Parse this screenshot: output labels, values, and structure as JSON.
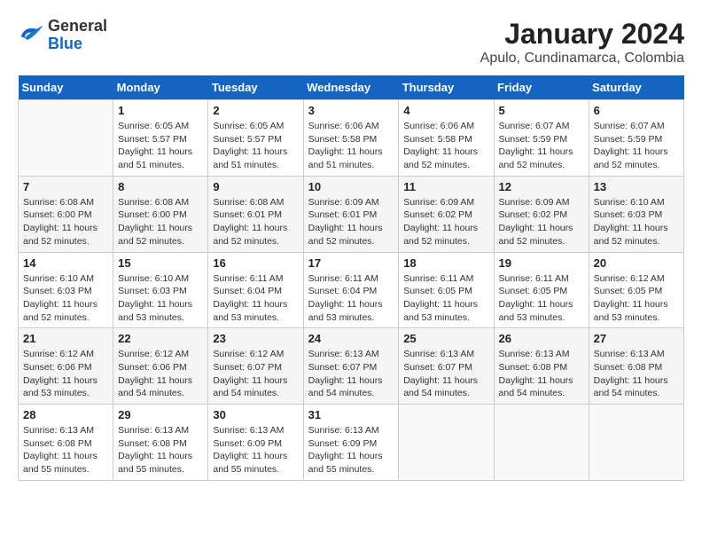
{
  "header": {
    "logo_line1": "General",
    "logo_line2": "Blue",
    "title": "January 2024",
    "subtitle": "Apulo, Cundinamarca, Colombia"
  },
  "weekdays": [
    "Sunday",
    "Monday",
    "Tuesday",
    "Wednesday",
    "Thursday",
    "Friday",
    "Saturday"
  ],
  "weeks": [
    [
      {
        "day": "",
        "sunrise": "",
        "sunset": "",
        "daylight": ""
      },
      {
        "day": "1",
        "sunrise": "Sunrise: 6:05 AM",
        "sunset": "Sunset: 5:57 PM",
        "daylight": "Daylight: 11 hours and 51 minutes."
      },
      {
        "day": "2",
        "sunrise": "Sunrise: 6:05 AM",
        "sunset": "Sunset: 5:57 PM",
        "daylight": "Daylight: 11 hours and 51 minutes."
      },
      {
        "day": "3",
        "sunrise": "Sunrise: 6:06 AM",
        "sunset": "Sunset: 5:58 PM",
        "daylight": "Daylight: 11 hours and 51 minutes."
      },
      {
        "day": "4",
        "sunrise": "Sunrise: 6:06 AM",
        "sunset": "Sunset: 5:58 PM",
        "daylight": "Daylight: 11 hours and 52 minutes."
      },
      {
        "day": "5",
        "sunrise": "Sunrise: 6:07 AM",
        "sunset": "Sunset: 5:59 PM",
        "daylight": "Daylight: 11 hours and 52 minutes."
      },
      {
        "day": "6",
        "sunrise": "Sunrise: 6:07 AM",
        "sunset": "Sunset: 5:59 PM",
        "daylight": "Daylight: 11 hours and 52 minutes."
      }
    ],
    [
      {
        "day": "7",
        "sunrise": "Sunrise: 6:08 AM",
        "sunset": "Sunset: 6:00 PM",
        "daylight": "Daylight: 11 hours and 52 minutes."
      },
      {
        "day": "8",
        "sunrise": "Sunrise: 6:08 AM",
        "sunset": "Sunset: 6:00 PM",
        "daylight": "Daylight: 11 hours and 52 minutes."
      },
      {
        "day": "9",
        "sunrise": "Sunrise: 6:08 AM",
        "sunset": "Sunset: 6:01 PM",
        "daylight": "Daylight: 11 hours and 52 minutes."
      },
      {
        "day": "10",
        "sunrise": "Sunrise: 6:09 AM",
        "sunset": "Sunset: 6:01 PM",
        "daylight": "Daylight: 11 hours and 52 minutes."
      },
      {
        "day": "11",
        "sunrise": "Sunrise: 6:09 AM",
        "sunset": "Sunset: 6:02 PM",
        "daylight": "Daylight: 11 hours and 52 minutes."
      },
      {
        "day": "12",
        "sunrise": "Sunrise: 6:09 AM",
        "sunset": "Sunset: 6:02 PM",
        "daylight": "Daylight: 11 hours and 52 minutes."
      },
      {
        "day": "13",
        "sunrise": "Sunrise: 6:10 AM",
        "sunset": "Sunset: 6:03 PM",
        "daylight": "Daylight: 11 hours and 52 minutes."
      }
    ],
    [
      {
        "day": "14",
        "sunrise": "Sunrise: 6:10 AM",
        "sunset": "Sunset: 6:03 PM",
        "daylight": "Daylight: 11 hours and 52 minutes."
      },
      {
        "day": "15",
        "sunrise": "Sunrise: 6:10 AM",
        "sunset": "Sunset: 6:03 PM",
        "daylight": "Daylight: 11 hours and 53 minutes."
      },
      {
        "day": "16",
        "sunrise": "Sunrise: 6:11 AM",
        "sunset": "Sunset: 6:04 PM",
        "daylight": "Daylight: 11 hours and 53 minutes."
      },
      {
        "day": "17",
        "sunrise": "Sunrise: 6:11 AM",
        "sunset": "Sunset: 6:04 PM",
        "daylight": "Daylight: 11 hours and 53 minutes."
      },
      {
        "day": "18",
        "sunrise": "Sunrise: 6:11 AM",
        "sunset": "Sunset: 6:05 PM",
        "daylight": "Daylight: 11 hours and 53 minutes."
      },
      {
        "day": "19",
        "sunrise": "Sunrise: 6:11 AM",
        "sunset": "Sunset: 6:05 PM",
        "daylight": "Daylight: 11 hours and 53 minutes."
      },
      {
        "day": "20",
        "sunrise": "Sunrise: 6:12 AM",
        "sunset": "Sunset: 6:05 PM",
        "daylight": "Daylight: 11 hours and 53 minutes."
      }
    ],
    [
      {
        "day": "21",
        "sunrise": "Sunrise: 6:12 AM",
        "sunset": "Sunset: 6:06 PM",
        "daylight": "Daylight: 11 hours and 53 minutes."
      },
      {
        "day": "22",
        "sunrise": "Sunrise: 6:12 AM",
        "sunset": "Sunset: 6:06 PM",
        "daylight": "Daylight: 11 hours and 54 minutes."
      },
      {
        "day": "23",
        "sunrise": "Sunrise: 6:12 AM",
        "sunset": "Sunset: 6:07 PM",
        "daylight": "Daylight: 11 hours and 54 minutes."
      },
      {
        "day": "24",
        "sunrise": "Sunrise: 6:13 AM",
        "sunset": "Sunset: 6:07 PM",
        "daylight": "Daylight: 11 hours and 54 minutes."
      },
      {
        "day": "25",
        "sunrise": "Sunrise: 6:13 AM",
        "sunset": "Sunset: 6:07 PM",
        "daylight": "Daylight: 11 hours and 54 minutes."
      },
      {
        "day": "26",
        "sunrise": "Sunrise: 6:13 AM",
        "sunset": "Sunset: 6:08 PM",
        "daylight": "Daylight: 11 hours and 54 minutes."
      },
      {
        "day": "27",
        "sunrise": "Sunrise: 6:13 AM",
        "sunset": "Sunset: 6:08 PM",
        "daylight": "Daylight: 11 hours and 54 minutes."
      }
    ],
    [
      {
        "day": "28",
        "sunrise": "Sunrise: 6:13 AM",
        "sunset": "Sunset: 6:08 PM",
        "daylight": "Daylight: 11 hours and 55 minutes."
      },
      {
        "day": "29",
        "sunrise": "Sunrise: 6:13 AM",
        "sunset": "Sunset: 6:08 PM",
        "daylight": "Daylight: 11 hours and 55 minutes."
      },
      {
        "day": "30",
        "sunrise": "Sunrise: 6:13 AM",
        "sunset": "Sunset: 6:09 PM",
        "daylight": "Daylight: 11 hours and 55 minutes."
      },
      {
        "day": "31",
        "sunrise": "Sunrise: 6:13 AM",
        "sunset": "Sunset: 6:09 PM",
        "daylight": "Daylight: 11 hours and 55 minutes."
      },
      {
        "day": "",
        "sunrise": "",
        "sunset": "",
        "daylight": ""
      },
      {
        "day": "",
        "sunrise": "",
        "sunset": "",
        "daylight": ""
      },
      {
        "day": "",
        "sunrise": "",
        "sunset": "",
        "daylight": ""
      }
    ]
  ]
}
